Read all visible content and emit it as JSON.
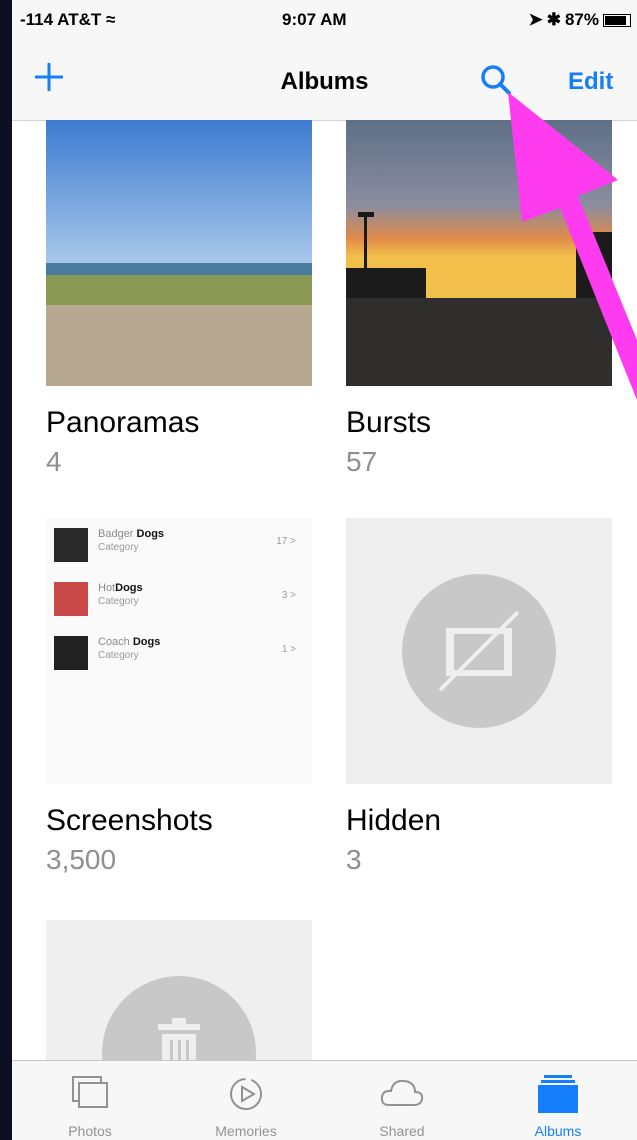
{
  "status_bar": {
    "carrier": "-114 AT&T",
    "time": "9:07 AM",
    "battery": "87%",
    "battery_level": 0.87
  },
  "nav": {
    "title": "Albums",
    "edit_label": "Edit"
  },
  "albums": [
    {
      "name": "Panoramas",
      "count": "4"
    },
    {
      "name": "Bursts",
      "count": "57"
    },
    {
      "name": "Screenshots",
      "count": "3,500"
    },
    {
      "name": "Hidden",
      "count": "3"
    }
  ],
  "screenshot_preview": [
    {
      "title_a": "Badger ",
      "title_b": "Dogs",
      "category": "Category",
      "count": "17 >"
    },
    {
      "title_a": "Hot",
      "title_b": "Dogs",
      "category": "Category",
      "count": "3 >"
    },
    {
      "title_a": "Coach ",
      "title_b": "Dogs",
      "category": "Category",
      "count": "1 >"
    }
  ],
  "tabs": [
    {
      "label": "Photos",
      "icon": "photos-icon"
    },
    {
      "label": "Memories",
      "icon": "memories-icon"
    },
    {
      "label": "Shared",
      "icon": "cloud-icon"
    },
    {
      "label": "Albums",
      "icon": "albums-icon",
      "active": true
    }
  ],
  "colors": {
    "accent": "#147efb",
    "annotation_arrow": "#ff3bf0"
  }
}
